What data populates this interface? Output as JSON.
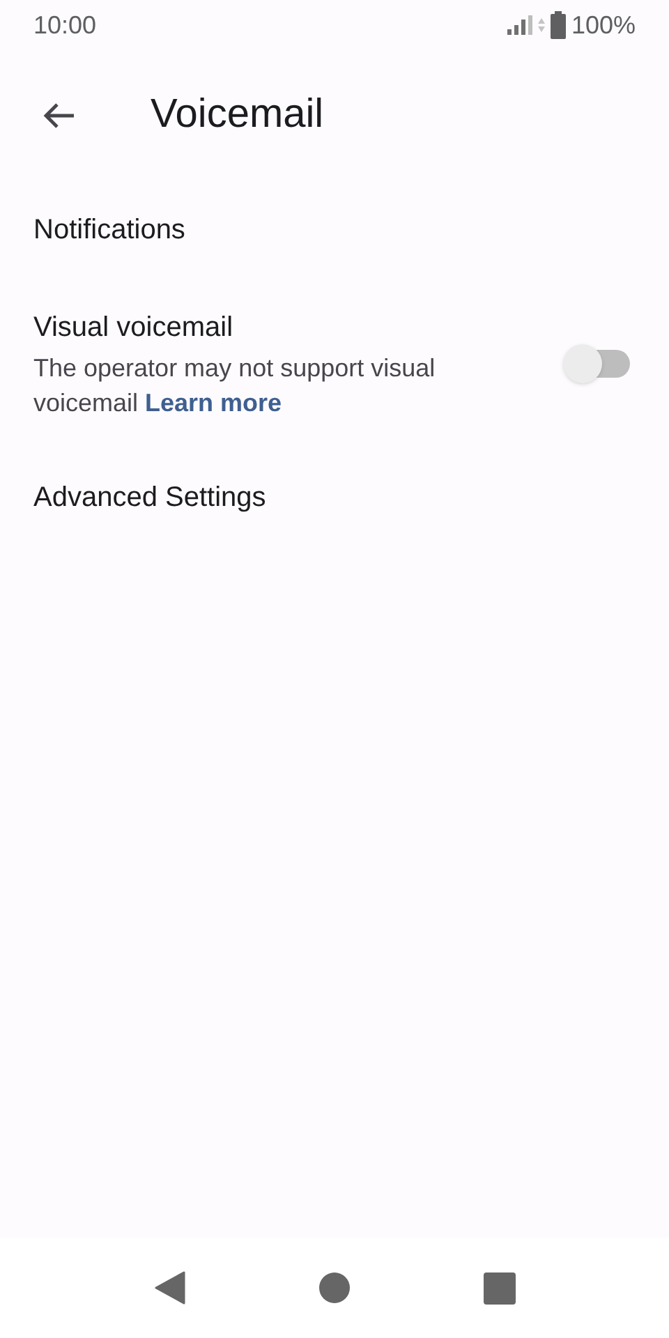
{
  "status_bar": {
    "time": "10:00",
    "battery": "100%"
  },
  "app_bar": {
    "title": "Voicemail"
  },
  "items": [
    {
      "kind": "plain",
      "title": "Notifications"
    },
    {
      "kind": "switch",
      "title": "Visual voicemail",
      "summary": "The operator may not support visual voicemail",
      "link": "Learn more",
      "on": false
    },
    {
      "kind": "plain",
      "title": "Advanced Settings"
    }
  ]
}
